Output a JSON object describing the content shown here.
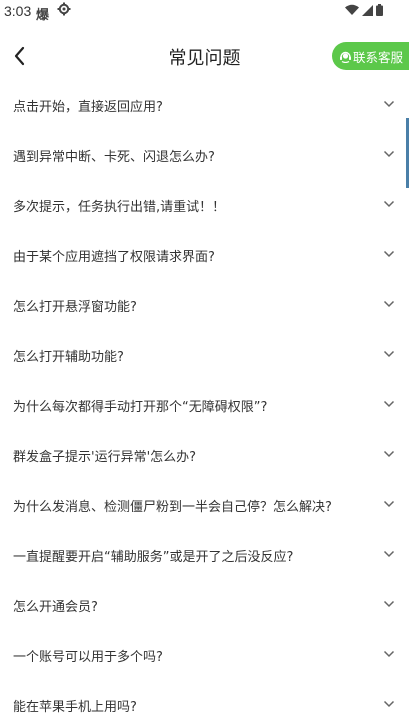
{
  "status_bar": {
    "time": "3:03",
    "app_glyph": "爆"
  },
  "header": {
    "title": "常见问题",
    "back_icon": "chevron-left-icon",
    "contact_label": "联系客服",
    "contact_icon": "headset-icon"
  },
  "colors": {
    "accent": "#5cc84a",
    "text": "#333333",
    "chevron": "#666666"
  },
  "faq": [
    {
      "question": "点击开始，直接返回应用?"
    },
    {
      "question": "遇到异常中断、卡死、闪退怎么办?"
    },
    {
      "question": "多次提示，任务执行出错,请重试！！"
    },
    {
      "question": "由于某个应用遮挡了权限请求界面?"
    },
    {
      "question": "怎么打开悬浮窗功能?"
    },
    {
      "question": "怎么打开辅助功能?"
    },
    {
      "question": "为什么每次都得手动打开那个“无障碍权限”?"
    },
    {
      "question": "群发盒子提示'运行异常'怎么办?"
    },
    {
      "question": "为什么发消息、检测僵尸粉到一半会自己停？怎么解决?"
    },
    {
      "question": "一直提醒要开启“辅助服务”或是开了之后没反应?"
    },
    {
      "question": "怎么开通会员?"
    },
    {
      "question": "一个账号可以用于多个吗?"
    },
    {
      "question": "能在苹果手机上用吗?"
    }
  ]
}
